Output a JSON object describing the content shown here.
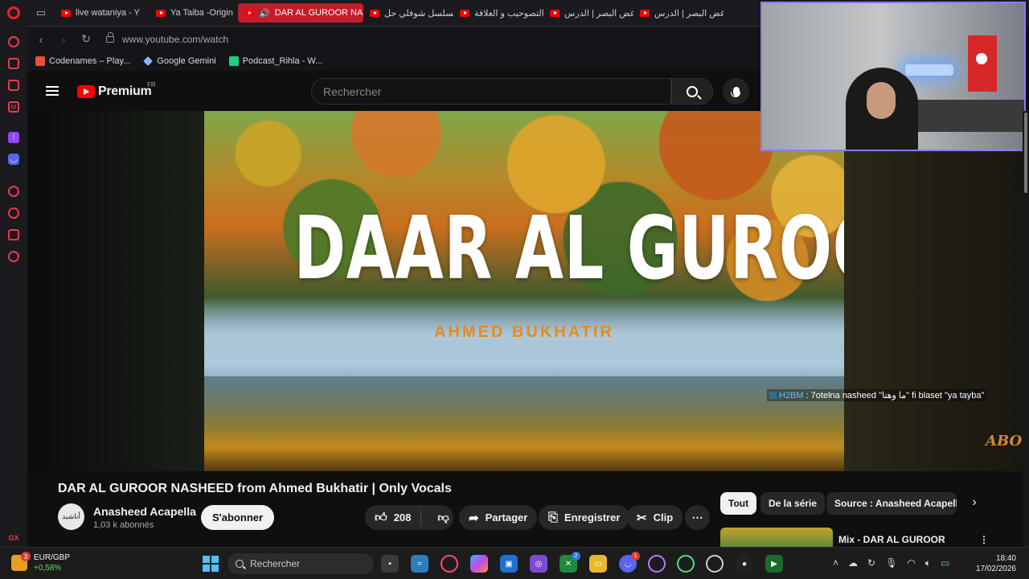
{
  "browser": {
    "tabs": [
      {
        "label": "live wataniya - Y",
        "active": false
      },
      {
        "label": "Ya Taiba -Origin",
        "active": false
      },
      {
        "label": "DAR AL GUROOR NAS",
        "active": true
      },
      {
        "label": "مسلسل شوفلي حل",
        "active": false
      },
      {
        "label": "التصوحيب و العلاقة",
        "active": false
      },
      {
        "label": "غض البصر | الدرس",
        "active": false
      },
      {
        "label": "غض البصر | الدرس",
        "active": false
      }
    ],
    "url": "www.youtube.com/watch",
    "bookmarks": [
      {
        "label": "Codenames – Play...",
        "color": "#e84f3b"
      },
      {
        "label": "Google Gemini",
        "color": "#8ab4f8"
      },
      {
        "label": "Podcast_Rihla - W...",
        "color": "#21d07a"
      }
    ],
    "sidebar_bottom": "GX"
  },
  "youtube": {
    "logo_text": "Premium",
    "region": "FR",
    "search_placeholder": "Rechercher",
    "thumbnail": {
      "title": "DAAR AL GUROOR",
      "artist": "AHMED BUKHATIR",
      "watermark": "ABO"
    },
    "chat_overlay": {
      "user": "H2BM",
      "message": ": 7otelna nasheed \"ما وهتا\" fi blaset \"ya tayba\""
    },
    "video": {
      "title": "DAR AL GUROOR NASHEED from Ahmed Bukhatir | Only Vocals",
      "channel": "Anasheed Acapella",
      "subscribers": "1,03 k abonnés",
      "avatar_text": "أناشيد",
      "subscribe_label": "S'abonner",
      "likes": "208",
      "share_label": "Partager",
      "save_label": "Enregistrer",
      "clip_label": "Clip"
    },
    "chips": [
      "Tout",
      "De la série",
      "Source : Anasheed Acapella"
    ],
    "recommendation": {
      "title": "Mix - DAR AL GUROOR"
    }
  },
  "taskbar": {
    "stock_pair": "EUR/GBP",
    "stock_change": "+0,58%",
    "stock_badge": "3",
    "search_label": "Rechercher",
    "xbox_badge": "2",
    "discord_badge": "1",
    "time": "18:40",
    "date": "17/02/2026"
  },
  "colors": {
    "accent_red": "#ff0000",
    "opera_red": "#ff1b2d",
    "webcam_border": "#8a7cf0"
  }
}
